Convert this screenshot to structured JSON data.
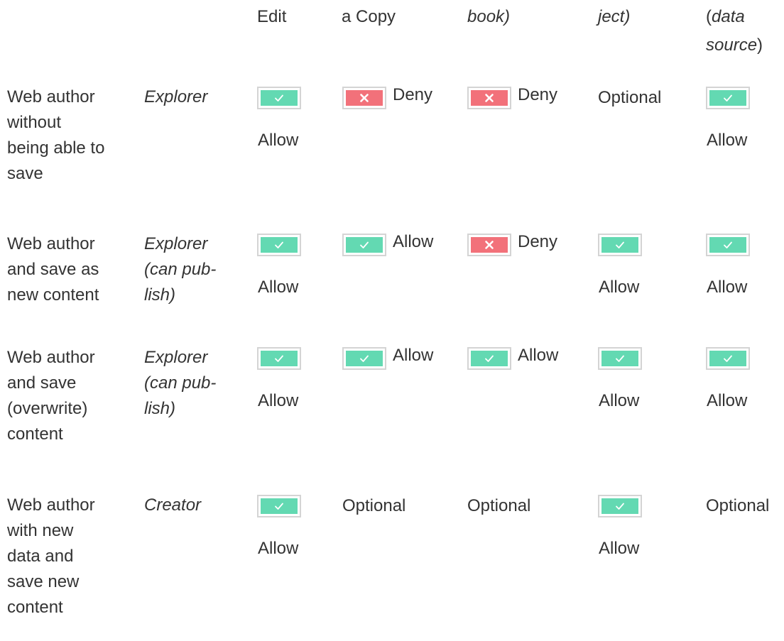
{
  "header": {
    "col_edit": "Edit",
    "col_copy": "a Copy",
    "col_workbook": "book)",
    "col_project": "ject)",
    "col_ds_open": "(",
    "col_ds_italic_1": "data",
    "col_ds_italic_2": "source",
    "col_ds_close": ")"
  },
  "rows": [
    {
      "task_lines": [
        "Web author",
        "without",
        "being able to",
        "save"
      ],
      "role_lines": [
        "Explorer"
      ],
      "cells": [
        {
          "status": "allow",
          "label": "Allow"
        },
        {
          "status": "deny",
          "label": "Deny"
        },
        {
          "status": "deny",
          "label": "Deny"
        },
        {
          "status": "text",
          "label": "Optional"
        },
        {
          "status": "allow",
          "label": "Allow"
        }
      ]
    },
    {
      "task_lines": [
        "Web author",
        "and save as",
        "new content"
      ],
      "role_lines": [
        "Explorer",
        "(can pub-",
        "lish)"
      ],
      "cells": [
        {
          "status": "allow",
          "label": "Allow"
        },
        {
          "status": "allow",
          "label": "Allow"
        },
        {
          "status": "deny",
          "label": "Deny"
        },
        {
          "status": "allow",
          "label": "Allow"
        },
        {
          "status": "allow",
          "label": "Allow"
        }
      ]
    },
    {
      "task_lines": [
        "Web author",
        "and save",
        "(overwrite)",
        "content"
      ],
      "role_lines": [
        "Explorer",
        "(can pub-",
        "lish)"
      ],
      "cells": [
        {
          "status": "allow",
          "label": "Allow"
        },
        {
          "status": "allow",
          "label": "Allow"
        },
        {
          "status": "allow",
          "label": "Allow"
        },
        {
          "status": "allow",
          "label": "Allow"
        },
        {
          "status": "allow",
          "label": "Allow"
        }
      ]
    },
    {
      "task_lines": [
        "Web author",
        "with new",
        "data and",
        "save new",
        "content"
      ],
      "role_lines": [
        "Creator"
      ],
      "cells": [
        {
          "status": "allow",
          "label": "Allow"
        },
        {
          "status": "text",
          "label": "Optional"
        },
        {
          "status": "text",
          "label": "Optional"
        },
        {
          "status": "allow",
          "label": "Allow"
        },
        {
          "status": "text",
          "label": "Optional"
        }
      ]
    }
  ],
  "colors": {
    "allow": "#63d9b2",
    "deny": "#f2717a",
    "badge_border": "#d4d4d4",
    "text": "#333333"
  },
  "icons": {
    "allow": "check-icon",
    "deny": "x-icon"
  }
}
